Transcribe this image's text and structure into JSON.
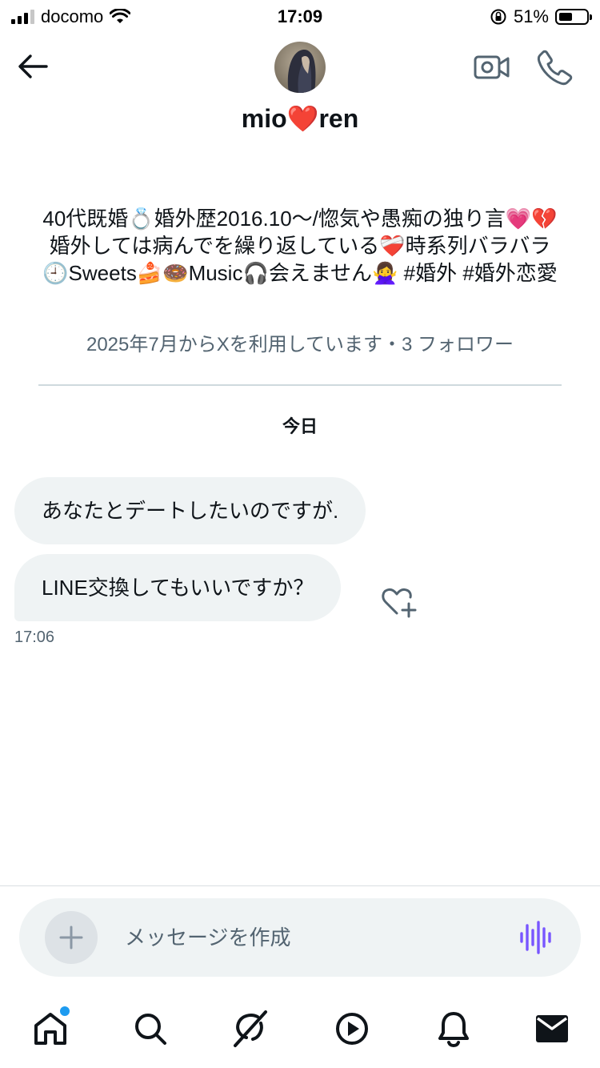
{
  "status_bar": {
    "carrier": "docomo",
    "time": "17:09",
    "battery": "51%",
    "battery_level": 0.51
  },
  "header": {
    "display_name_part1": "mio",
    "display_name_emoji": "❤️",
    "display_name_part2": "ren",
    "back_icon": "arrow-left-icon",
    "video_icon": "video-camera-icon",
    "call_icon": "phone-icon"
  },
  "profile": {
    "bio": "40代既婚💍婚外歴2016.10～/惚気や愚痴の独り言💗💔婚外しては病んでを繰り返している❤️‍🩹時系列バラバラ🕘Sweets🍰🍩Music🎧会えません🙅‍♀️ #婚外 #婚外恋愛",
    "joined": "2025年7月からXを利用しています・3 フォロワー"
  },
  "conversation": {
    "date_label": "今日",
    "messages": [
      {
        "text": "あなたとデートしたいのですが."
      },
      {
        "text": "LINE交換してもいいですか？"
      }
    ],
    "last_time": "17:06",
    "react_icon": "heart-plus-icon"
  },
  "composer": {
    "placeholder": "メッセージを作成",
    "add_icon": "plus-icon",
    "voice_icon": "voice-waveform-icon"
  },
  "tabbar": {
    "items": [
      {
        "icon": "home-icon"
      },
      {
        "icon": "search-icon"
      },
      {
        "icon": "grok-icon"
      },
      {
        "icon": "play-icon"
      },
      {
        "icon": "bell-icon"
      },
      {
        "icon": "mail-icon"
      }
    ]
  },
  "colors": {
    "accent": "#1d9bf0",
    "text": "#0f1419",
    "secondary_text": "#536471",
    "bubble": "#eff3f4",
    "voice": "#7856ff"
  }
}
